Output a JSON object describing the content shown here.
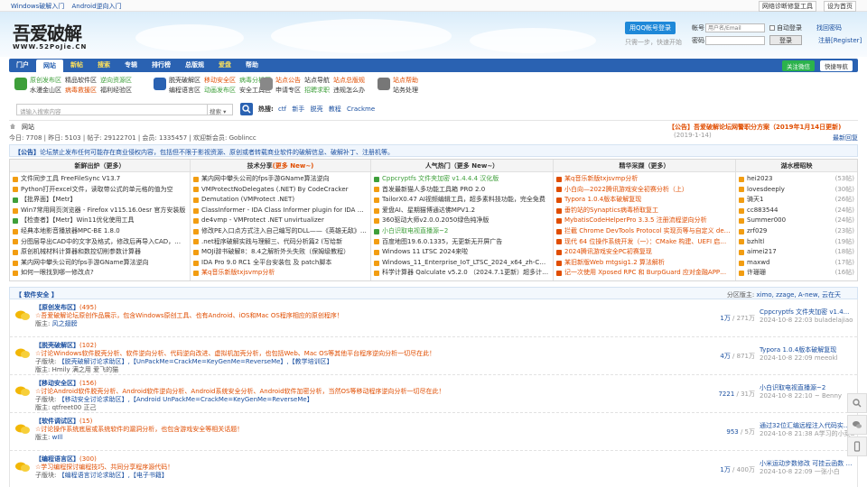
{
  "topbar": {
    "links": [
      "Windows破解入门",
      "Android逆向入门"
    ],
    "right_links": [
      "网络诊断修复工具",
      "设为首页"
    ]
  },
  "header": {
    "logo_cn": "吾爱破解",
    "logo_en": "WWW.52PoJie.CN",
    "qq_button": "用QQ帐号登录",
    "qq_sub": "只需一步，快速开始",
    "username_label": "帐号",
    "username_placeholder": "用户名/Email",
    "password_label": "密码",
    "autologin": "自动登录",
    "forgot": "找回密码",
    "login_button": "登录",
    "register": "注册[Register]"
  },
  "nav": {
    "items": [
      "门户",
      "网站",
      "新帖",
      "搜索",
      "专辑",
      "排行榜",
      "总版规",
      "爱盘",
      "帮助"
    ],
    "active": 1,
    "follow": "关注微信",
    "quick": "快捷导航"
  },
  "subnav": [
    {
      "rows": [
        [
          "原创发布区",
          "精品软件区",
          "逆向资源区"
        ],
        [
          "水漫金山区",
          "病毒救援区",
          "福利经验区"
        ]
      ]
    },
    {
      "rows": [
        [
          "脱壳破解区",
          "移动安全区",
          "病毒分析区"
        ],
        [
          "编程语言区",
          "动画发布区",
          "安全工具区"
        ]
      ]
    },
    {
      "rows": [
        [
          "站点公告",
          "站点导航",
          "站点总版规"
        ],
        [
          "申请专区",
          "招聘求职",
          "违规怎么办"
        ]
      ]
    },
    {
      "rows": [
        [
          "站点帮助"
        ],
        [
          "站务处理"
        ]
      ]
    }
  ],
  "search": {
    "placeholder": "请输入搜索内容",
    "select": "搜索",
    "hot_label": "热搜:",
    "hot": [
      "ctf",
      "新手",
      "脱壳",
      "教程",
      "Crackme"
    ]
  },
  "crumb": {
    "home": "网站",
    "announce_label": "【公告】",
    "announce": "吾爱破解论坛网警职分方案（2019年1月14日更新)",
    "announce_date": "(2019-1-14)"
  },
  "stats": {
    "text": "今日: 7708 | 昨日: 5103 | 帖子: 29122701 | 会员: 1335457 | 欢迎新会员: Goblincc",
    "right": "最新回复"
  },
  "notice": {
    "label": "【公告】",
    "text": "论坛禁止发布任何可能存在商业侵权内容，包括但不限于影视资源、原创或者转载商业软件的破解信息、破解补丁、注册机等。"
  },
  "panels": [
    {
      "title": "新鲜出炉（更多）",
      "new": "",
      "color": "#f29d12",
      "items": [
        {
          "t": "文件同步工具 FreeFileSync V13.7",
          "c": "#f29d12"
        },
        {
          "t": "Python打开excel文件，读取带公式的单元格的值为空",
          "c": "#f29d12"
        },
        {
          "t": "【批界面】【Metr】",
          "c": "#3e9f3a"
        },
        {
          "t": "Win7常用网页浏览器 - Firefox v115.16.0esr 官方安装版",
          "c": "#f29d12"
        },
        {
          "t": "【检查者】【Metr】Win11优化使用工具",
          "c": "#3e9f3a"
        },
        {
          "t": "经典本地影音播放器MPC-BE 1.8.0",
          "c": "#f29d12"
        },
        {
          "t": "分图层导出CAD中的文字及格式，修改后再导入CAD，达到批量",
          "c": "#f29d12"
        },
        {
          "t": "原创机械材料计算器和数控切削参数计算器",
          "c": "#f29d12"
        },
        {
          "t": "某内网中攀头公司的fps手游GName算法逆向",
          "c": "#f29d12"
        },
        {
          "t": "如何一眼找到哪一修改点?",
          "c": "#f29d12"
        }
      ]
    },
    {
      "title": "技术分享",
      "new": "(更多 New~)",
      "color": "#f29d12",
      "items": [
        {
          "t": "某内网中攀头公司的fps手游GName算法逆向",
          "c": "#f29d12"
        },
        {
          "t": "VMProtectNoDelegates (.NET) By CodeCracker",
          "c": "#f29d12"
        },
        {
          "t": "Demutation (VMProtect .NET)",
          "c": "#f29d12"
        },
        {
          "t": "ClassInformer - IDA Class Informer plugin for IDA 8.x and 9....",
          "c": "#f29d12"
        },
        {
          "t": "de4vmp - VMProtect .NET unvirtualizer",
          "c": "#f29d12"
        },
        {
          "t": "修改PE入口点方式注入自己编写的DLL——《英雄无敌》1代小",
          "c": "#f29d12"
        },
        {
          "t": ".net程序破解实践与理解三、代码分析篇2 (写给新",
          "c": "#f29d12"
        },
        {
          "t": "MOJi辞书破解8：8.4之解析外头失败（保姆级教程）",
          "c": "#f29d12"
        },
        {
          "t": "IDA Pro 9.0 RC1 全平台安装包 及 patch脚本",
          "c": "#f29d12"
        },
        {
          "t": "某q音乐新版txjsvmp分析",
          "c": "#f29d12",
          "red": true
        }
      ]
    },
    {
      "title": "人气热门（更多 New~）",
      "new": "",
      "color": "#f29d12",
      "items": [
        {
          "t": "Cppcryptfs 文件夹加密 v1.4.4.4 汉化版",
          "c": "#3e9f3a",
          "green": true
        },
        {
          "t": "首发最新猫人多功能工具箱 PRO 2.0",
          "c": "#f29d12"
        },
        {
          "t": "TailorX0.47 AI视频编辑工具，超多素料技功能，完全免费",
          "c": "#f29d12"
        },
        {
          "t": "爱盘AI、星期猫博通达佛MPV1.2",
          "c": "#f29d12"
        },
        {
          "t": "360驱动大师v2.0.0.2050绿色纯净版",
          "c": "#f29d12"
        },
        {
          "t": "小白识取电视直播源~2",
          "c": "#3e9f3a",
          "green": true
        },
        {
          "t": "百度地图19.6.0.1335，无更新无开屏广告",
          "c": "#f29d12"
        },
        {
          "t": "Windows 11 LTSC 2024来啦",
          "c": "#f29d12"
        },
        {
          "t": "Windows_11_Enterprise_IoT_LTSC_2024_x64_zh-CN_24H2_26100",
          "c": "#f29d12"
        },
        {
          "t": "科学计算器 Qalculate v5.2.0 （2024.7.1更新）超多计算抽象功能",
          "c": "#f29d12"
        }
      ]
    },
    {
      "title": "精华采撷（更多）",
      "new": "",
      "color": "#f29d12",
      "items": [
        {
          "t": "某q音乐新版txjsvmp分析",
          "c": "#e04d00",
          "red": true
        },
        {
          "t": "小白向—2022腾讯游戏安全初赛分析（上）",
          "c": "#e04d00",
          "red": true
        },
        {
          "t": "Typora 1.0.4版本破解复现",
          "c": "#e04d00",
          "red": true
        },
        {
          "t": "垂钓站的Synaptics病毒桥取复工",
          "c": "#e04d00",
          "red": true
        },
        {
          "t": "MybatisCodeHelperPro 3.3.5 注册流程逆向分析",
          "c": "#e04d00",
          "red": true
        },
        {
          "t": "拦截 Chrome DevTools Protocol 实现页等与自定义 debugger",
          "c": "#e04d00",
          "red": true
        },
        {
          "t": "现代 64 位操作系统开发（一）：CMake 构建、UEFI 启动、fra",
          "c": "#e04d00",
          "red": true
        },
        {
          "t": "2024腾讯游戏安全PC初赛复现",
          "c": "#e04d00",
          "red": true
        },
        {
          "t": "某旧新版Web mtgsig1.2 算法解析",
          "c": "#e04d00",
          "red": true
        },
        {
          "t": "记一次使用 Xposed RPC 和 BurpGuard 应对金融APP参数签名",
          "c": "#e04d00",
          "red": true
        }
      ]
    },
    {
      "title": "湖水榜昭映",
      "new": "",
      "color": "#f29d12",
      "items": [
        {
          "t": "hei2023",
          "c": "#f29d12",
          "n": "(53帖)"
        },
        {
          "t": "lovesdeeply",
          "c": "#f29d12",
          "n": "(30帖)"
        },
        {
          "t": "骑天1",
          "c": "#f29d12",
          "n": "(26帖)"
        },
        {
          "t": "cc883544",
          "c": "#f29d12",
          "n": "(24帖)"
        },
        {
          "t": "Summer000",
          "c": "#f29d12",
          "n": "(24帖)"
        },
        {
          "t": "zrf029",
          "c": "#f29d12",
          "n": "(23帖)"
        },
        {
          "t": "bzhltl",
          "c": "#f29d12",
          "n": "(19帖)"
        },
        {
          "t": "aimei217",
          "c": "#f29d12",
          "n": "(18帖)"
        },
        {
          "t": "maxwd",
          "c": "#f29d12",
          "n": "(17帖)"
        },
        {
          "t": "许珊珊",
          "c": "#f29d12",
          "n": "(16帖)"
        }
      ]
    }
  ],
  "section": {
    "title": "【 软件安全 】",
    "moderators_label": "分区版主: ",
    "moderators": "ximo, zzage, A-new, 云在天"
  },
  "forums": [
    {
      "title": "【原创发布区】",
      "n": "(495)",
      "desc": "☆吾爱破解论坛原创作品展示，包含Windows原创工具、也有Android、iOS和Mac OS程序相应的原创程序！",
      "sub_label": "版主: ",
      "sub": "风之翅膀",
      "count": "1万",
      "total": " / 271万",
      "last_title": "Cppcryptfs 文件夹加密 v1.4...",
      "last_meta": "2024-10-8 22:03 buladelajiao"
    },
    {
      "title": "【脱壳破解区】",
      "n": "(102)",
      "desc": "☆讨论Windows软件脱壳分析、软件逆向分析、代码逆向改进、虚拟机加壳分析，也包括Web、Mac OS等其他平台程序逆向分析一切尽在此！",
      "sub_label": "子版块: ",
      "sub": "【脱壳破解讨论求助区】,【UnPackMe=CrackMe=KeyGenMe=ReverseMe】,【教学培训区】",
      "mod": "版主: Hmily 满之用 爱飞的猫",
      "count": "4万",
      "total": " / 871万",
      "last_title": "Typora 1.0.4版本破解复现",
      "last_meta": "2024-10-8 22:09 meeokl"
    },
    {
      "title": "【移动安全区】",
      "n": "(156)",
      "desc": "☆讨论Android软件脱壳分析、Android软件逆向分析、Android系统安全分析、Android软件加密分析，当然OS等移动程序逆向分析一切尽在此！",
      "sub_label": "子版块: ",
      "sub": "【移动安全讨论求助区】,【Android UnPackMe=CrackMe=KeyGenMe=ReverseMe】",
      "mod": "版主: qtfreet00 正己",
      "count": "7221",
      "total": " / 31万",
      "last_title": "小白识取电视直播源~2",
      "last_meta": "2024-10-8 22:10 ~ Benny"
    },
    {
      "title": "【软件调试区】",
      "n": "(15)",
      "desc": "☆讨论操作系统底层或系统软件的漏洞分析，也包含游戏安全等相关话题！",
      "sub_label": "版主: ",
      "sub": "wIll",
      "count": "953",
      "total": " / 5万",
      "last_title": "通过32位汇编远程注入代码实...",
      "last_meta": "2024-10-8 21:38 A学习的小菜鸟"
    },
    {
      "title": "【编程语言区】",
      "n": "(300)",
      "desc": "☆学习编程探讨编程技巧、共同分享程序源代码！",
      "sub_label": "子版块: ",
      "sub": "【编程语言讨论求助区】,【电子书籍】",
      "count": "1万",
      "total": " / 400万",
      "last_title": "小米运动步数修改 可挂云函数 20...",
      "last_meta": "2024-10-8 22:09 一张小白"
    }
  ],
  "colors": {
    "brand": "#2a62b2",
    "accent": "#e04d00",
    "link": "#1a4fa0"
  }
}
